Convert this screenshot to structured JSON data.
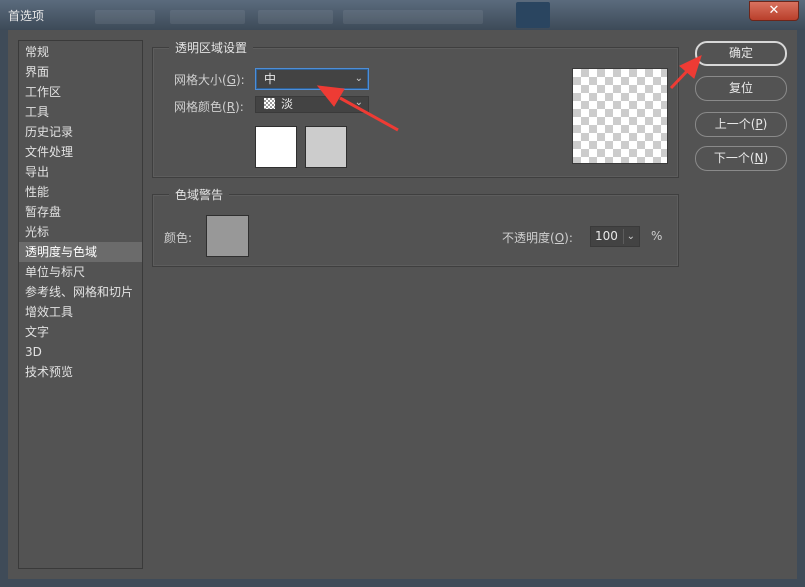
{
  "window": {
    "title": "首选项",
    "close_symbol": "✕"
  },
  "categories": [
    {
      "label": "常规"
    },
    {
      "label": "界面"
    },
    {
      "label": "工作区"
    },
    {
      "label": "工具"
    },
    {
      "label": "历史记录"
    },
    {
      "label": "文件处理"
    },
    {
      "label": "导出"
    },
    {
      "label": "性能"
    },
    {
      "label": "暂存盘"
    },
    {
      "label": "光标"
    },
    {
      "label": "透明度与色域",
      "selected": true
    },
    {
      "label": "单位与标尺"
    },
    {
      "label": "参考线、网格和切片"
    },
    {
      "label": "增效工具"
    },
    {
      "label": "文字"
    },
    {
      "label": "3D"
    },
    {
      "label": "技术预览"
    }
  ],
  "transparency": {
    "group_title": "透明区域设置",
    "grid_size": {
      "label_prefix": "网格大小(",
      "mnemonic": "G",
      "label_suffix": "):",
      "value": "中"
    },
    "grid_color": {
      "label_prefix": "网格颜色(",
      "mnemonic": "R",
      "label_suffix": "):",
      "value": "淡"
    },
    "swatch_colors": [
      "#ffffff",
      "#cccccc"
    ]
  },
  "gamut": {
    "group_title": "色域警告",
    "color_label": "颜色:",
    "swatch_color": "#989898",
    "opacity": {
      "label_prefix": "不透明度(",
      "mnemonic": "O",
      "label_suffix": "):",
      "value": "100",
      "unit": "%"
    }
  },
  "buttons": {
    "ok": "确定",
    "reset": "复位",
    "prev_prefix": "上一个(",
    "prev_mnemonic": "P",
    "prev_suffix": ")",
    "next_prefix": "下一个(",
    "next_mnemonic": "N",
    "next_suffix": ")"
  },
  "icons": {
    "dropdown": "chevron-down-icon",
    "pattern": "checker-pattern-icon"
  },
  "annotation_color": "#ee3b34"
}
